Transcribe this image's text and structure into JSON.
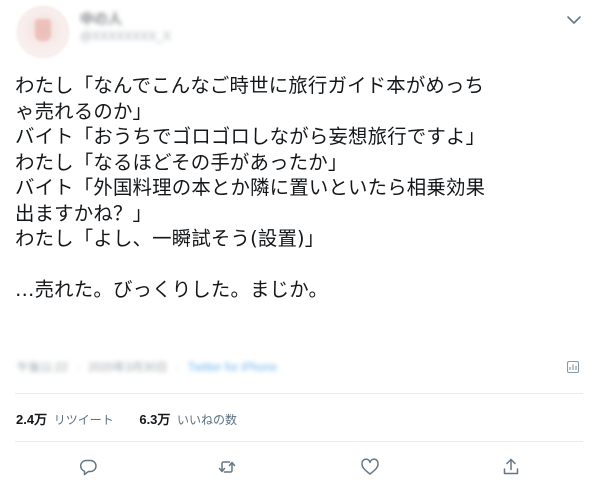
{
  "header": {
    "display_name": "中の人",
    "handle": "@XXXXXXXX_X",
    "menu_icon": "chevron-down-icon"
  },
  "tweet": {
    "lines": [
      "わたし「なんでこんなご時世に旅行ガイド本がめっち",
      "ゃ売れるのか」",
      "バイト「おうちでゴロゴロしながら妄想旅行ですよ」",
      "わたし「なるほどその手があったか」",
      "バイト「外国料理の本とか隣に置いといたら相乗効果",
      "出ますかね？」",
      "わたし「よし、一瞬試そう(設置)」",
      "",
      "…売れた。びっくりした。まじか。"
    ]
  },
  "meta": {
    "time": "午後11:22",
    "date": "2020年3月30日",
    "separator": "·",
    "via": "Twitter for iPhone"
  },
  "counts": {
    "retweets_value": "2.4万",
    "retweets_label": "リツイート",
    "likes_value": "6.3万",
    "likes_label": "いいねの数"
  },
  "actions": [
    "reply-icon",
    "retweet-icon",
    "like-icon",
    "share-icon"
  ],
  "colors": {
    "text": "#14171a",
    "secondary": "#5b7083",
    "icon": "#657786",
    "link": "#1da1f2",
    "divider": "#e6ecf0"
  }
}
